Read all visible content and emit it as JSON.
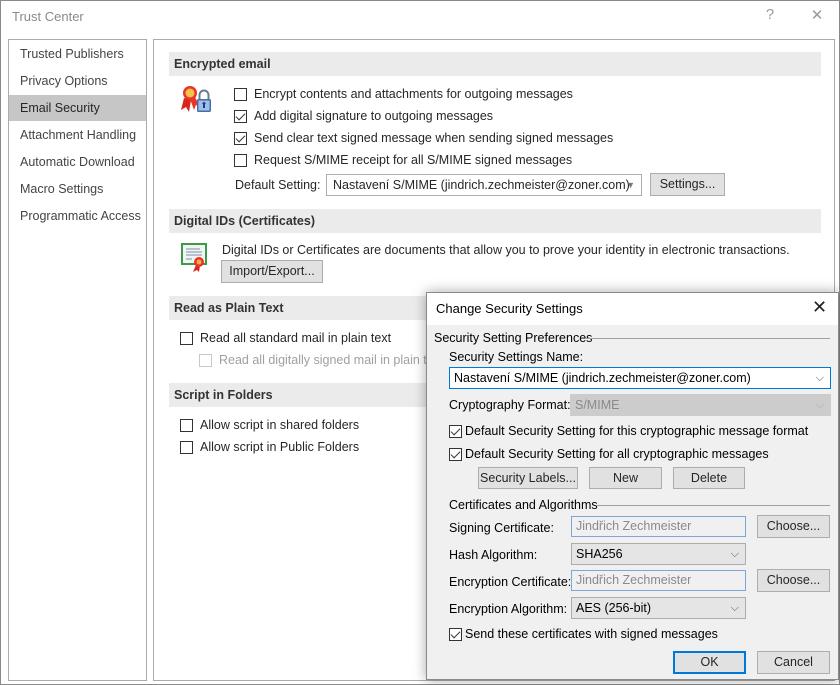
{
  "window": {
    "title": "Trust Center",
    "help_icon": "?",
    "close_icon": "✕"
  },
  "nav": {
    "items": [
      {
        "label": "Trusted Publishers",
        "selected": false
      },
      {
        "label": "Privacy Options",
        "selected": false
      },
      {
        "label": "Email Security",
        "selected": true
      },
      {
        "label": "Attachment Handling",
        "selected": false
      },
      {
        "label": "Automatic Download",
        "selected": false
      },
      {
        "label": "Macro Settings",
        "selected": false
      },
      {
        "label": "Programmatic Access",
        "selected": false
      }
    ]
  },
  "encrypted_email": {
    "header": "Encrypted email",
    "options": [
      {
        "label": "Encrypt contents and attachments for outgoing messages",
        "checked": false
      },
      {
        "label": "Add digital signature to outgoing messages",
        "checked": true
      },
      {
        "label": "Send clear text signed message when sending signed messages",
        "checked": true
      },
      {
        "label": "Request S/MIME receipt for all S/MIME signed messages",
        "checked": false
      }
    ],
    "default_setting_label": "Default Setting:",
    "default_setting_value": "Nastavení S/MIME (jindrich.zechmeister@zoner.com)",
    "settings_button": "Settings..."
  },
  "digital_ids": {
    "header": "Digital IDs (Certificates)",
    "description": "Digital IDs or Certificates are documents that allow you to prove your identity in electronic transactions.",
    "import_export_button": "Import/Export..."
  },
  "plain_text": {
    "header": "Read as Plain Text",
    "options": [
      {
        "label": "Read all standard mail in plain text",
        "checked": false,
        "disabled": false
      },
      {
        "label": "Read all digitally signed mail in plain text",
        "checked": false,
        "disabled": true
      }
    ]
  },
  "script_folders": {
    "header": "Script in Folders",
    "options": [
      {
        "label": "Allow script in shared folders",
        "checked": false
      },
      {
        "label": "Allow script in Public Folders",
        "checked": false
      }
    ]
  },
  "dialog": {
    "title": "Change Security Settings",
    "close_icon": "✕",
    "preferences_group": "Security Setting Preferences",
    "settings_name_label": "Security Settings Name:",
    "settings_name_value": "Nastavení S/MIME (jindrich.zechmeister@zoner.com)",
    "crypto_format_label": "Cryptography Format:",
    "crypto_format_value": "S/MIME",
    "default_this_format": {
      "label": "Default Security Setting for this cryptographic message format",
      "checked": true
    },
    "default_all": {
      "label": "Default Security Setting for all cryptographic messages",
      "checked": true
    },
    "security_labels_button": "Security Labels...",
    "new_button": "New",
    "delete_button": "Delete",
    "certs_group": "Certificates and Algorithms",
    "signing_cert_label": "Signing Certificate:",
    "signing_cert_value": "Jindřich Zechmeister",
    "hash_algo_label": "Hash Algorithm:",
    "hash_algo_value": "SHA256",
    "enc_cert_label": "Encryption Certificate:",
    "enc_cert_value": "Jindřich Zechmeister",
    "enc_algo_label": "Encryption Algorithm:",
    "enc_algo_value": "AES (256-bit)",
    "choose_button": "Choose...",
    "send_certs": {
      "label": "Send these certificates with signed messages",
      "checked": true
    },
    "ok_button": "OK",
    "cancel_button": "Cancel"
  }
}
